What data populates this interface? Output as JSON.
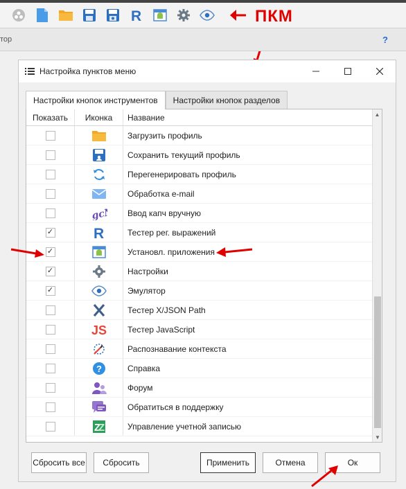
{
  "toolbar": {
    "icons": [
      "logo-icon",
      "new-file-icon",
      "open-folder-icon",
      "save-icon",
      "save-as-icon",
      "regex-tester-icon",
      "android-icon",
      "gear-icon",
      "eye-icon"
    ],
    "annotation": "ПКМ"
  },
  "subbar": {
    "truncated_text": "тор",
    "help": "?"
  },
  "dialog": {
    "title": "Настройка пунктов меню",
    "tabs": [
      "Настройки кнопок инструментов",
      "Настройки кнопок разделов"
    ],
    "columns": {
      "show": "Показать",
      "icon": "Иконка",
      "name": "Название"
    },
    "rows": [
      {
        "icon": "folder-icon",
        "name": "Загрузить профиль",
        "checked": false
      },
      {
        "icon": "save-profile-icon",
        "name": "Сохранить текущий профиль",
        "checked": false
      },
      {
        "icon": "regenerate-icon",
        "name": "Перегенерировать профиль",
        "checked": false
      },
      {
        "icon": "email-icon",
        "name": "Обработка e-mail",
        "checked": false
      },
      {
        "icon": "captcha-icon",
        "name": "Ввод капч вручную",
        "checked": false
      },
      {
        "icon": "regex-icon",
        "name": "Тестер рег. выражений",
        "checked": true
      },
      {
        "icon": "android-icon",
        "name": "Установл. приложения",
        "checked": true
      },
      {
        "icon": "gear-icon",
        "name": "Настройки",
        "checked": true
      },
      {
        "icon": "eye-icon",
        "name": "Эмулятор",
        "checked": true
      },
      {
        "icon": "xpath-icon",
        "name": "Тестер X/JSON Path",
        "checked": false
      },
      {
        "icon": "js-icon",
        "name": "Тестер JavaScript",
        "checked": false
      },
      {
        "icon": "context-icon",
        "name": "Распознавание контекста",
        "checked": false
      },
      {
        "icon": "help-icon",
        "name": "Справка",
        "checked": false
      },
      {
        "icon": "forum-icon",
        "name": "Форум",
        "checked": false
      },
      {
        "icon": "support-icon",
        "name": "Обратиться в поддержку",
        "checked": false
      },
      {
        "icon": "account-icon",
        "name": "Управление учетной записью",
        "checked": false
      }
    ],
    "buttons": {
      "reset_all": "Сбросить все",
      "reset": "Сбросить",
      "apply": "Применить",
      "cancel": "Отмена",
      "ok": "Ок"
    }
  },
  "colors": {
    "annotation": "#e00000",
    "accent_blue": "#2a6ad8"
  }
}
